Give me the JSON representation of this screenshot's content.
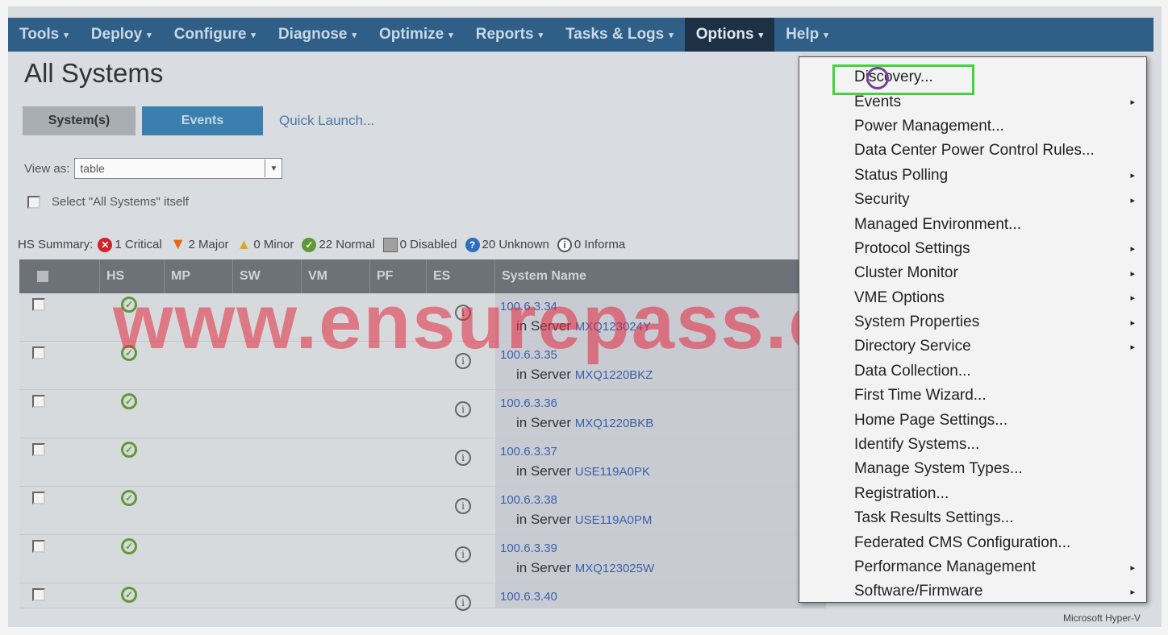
{
  "menubar": {
    "items": [
      {
        "label": "Tools"
      },
      {
        "label": "Deploy"
      },
      {
        "label": "Configure"
      },
      {
        "label": "Diagnose"
      },
      {
        "label": "Optimize"
      },
      {
        "label": "Reports"
      },
      {
        "label": "Tasks & Logs"
      },
      {
        "label": "Options"
      },
      {
        "label": "Help"
      }
    ],
    "arrow": "▾"
  },
  "page": {
    "title": "All Systems"
  },
  "tabs": {
    "systems": "System(s)",
    "events": "Events",
    "quick_launch": "Quick Launch..."
  },
  "view_as": {
    "label": "View as:",
    "value": "table"
  },
  "select_all": {
    "label": "Select \"All Systems\" itself"
  },
  "summary": {
    "label": "HS Summary:",
    "critical": "1 Critical",
    "major": "2 Major",
    "minor": "0 Minor",
    "normal": "22 Normal",
    "disabled": "0 Disabled",
    "unknown": "20 Unknown",
    "informational": "0 Informa"
  },
  "table": {
    "headers": [
      "",
      "HS",
      "MP",
      "SW",
      "VM",
      "PF",
      "ES",
      "System Name"
    ],
    "rows": [
      {
        "ip": "100.6.3.34",
        "in_server": "in Server",
        "server": "MXQ123024Y"
      },
      {
        "ip": "100.6.3.35",
        "in_server": "in Server",
        "server": "MXQ1220BKZ"
      },
      {
        "ip": "100.6.3.36",
        "in_server": "in Server",
        "server": "MXQ1220BKB"
      },
      {
        "ip": "100.6.3.37",
        "in_server": "in Server",
        "server": "USE119A0PK"
      },
      {
        "ip": "100.6.3.38",
        "in_server": "in Server",
        "server": "USE119A0PM"
      },
      {
        "ip": "100.6.3.39",
        "in_server": "in Server",
        "server": "MXQ123025W"
      },
      {
        "ip": "100.6.3.40",
        "in_server": "",
        "server": ""
      }
    ]
  },
  "options_menu": {
    "items": [
      {
        "label": "Discovery...",
        "submenu": false
      },
      {
        "label": "Events",
        "submenu": true
      },
      {
        "label": "Power Management...",
        "submenu": false
      },
      {
        "label": "Data Center Power Control Rules...",
        "submenu": false
      },
      {
        "label": "Status Polling",
        "submenu": true
      },
      {
        "label": "Security",
        "submenu": true
      },
      {
        "label": "Managed Environment...",
        "submenu": false
      },
      {
        "label": "Protocol Settings",
        "submenu": true
      },
      {
        "label": "Cluster Monitor",
        "submenu": true
      },
      {
        "label": "VME Options",
        "submenu": true
      },
      {
        "label": "System Properties",
        "submenu": true
      },
      {
        "label": "Directory Service",
        "submenu": true
      },
      {
        "label": "Data Collection...",
        "submenu": false
      },
      {
        "label": "First Time Wizard...",
        "submenu": false
      },
      {
        "label": "Home Page Settings...",
        "submenu": false
      },
      {
        "label": "Identify Systems...",
        "submenu": false
      },
      {
        "label": "Manage System Types...",
        "submenu": false
      },
      {
        "label": "Registration...",
        "submenu": false
      },
      {
        "label": "Task Results Settings...",
        "submenu": false
      },
      {
        "label": "Federated CMS Configuration...",
        "submenu": false
      },
      {
        "label": "Performance Management",
        "submenu": true
      },
      {
        "label": "Software/Firmware",
        "submenu": true
      }
    ],
    "submenu_arrow": "▸",
    "highlight_color": "#43d33a"
  },
  "watermark": "www.ensurepass.com",
  "footer": "Microsoft Hyper-V"
}
